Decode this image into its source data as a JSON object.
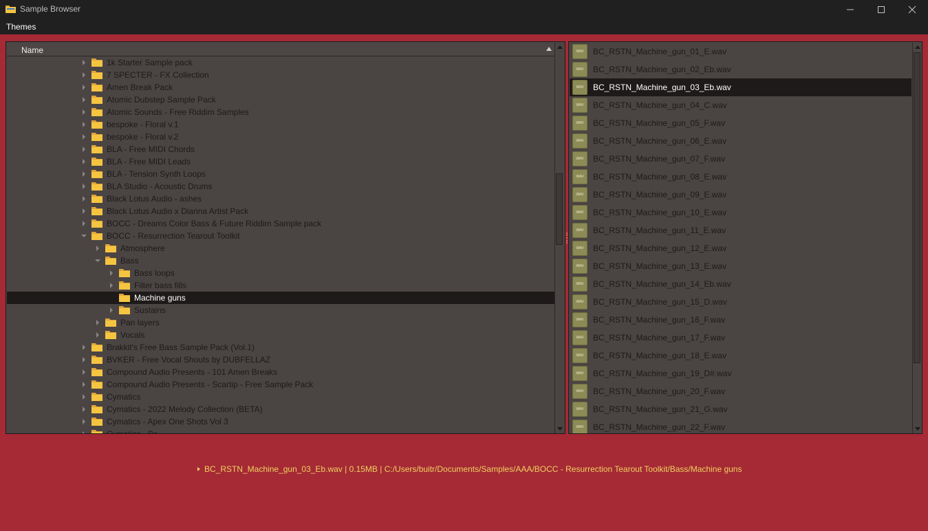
{
  "window": {
    "title": "Sample Browser"
  },
  "menu": {
    "items": [
      "Themes"
    ]
  },
  "tree": {
    "header": "Name",
    "rows": [
      {
        "label": "1k Starter Sample pack",
        "depth": 0,
        "expanded": false,
        "has_children": true
      },
      {
        "label": "7 SPECTER - FX Collection",
        "depth": 0,
        "expanded": false,
        "has_children": true
      },
      {
        "label": "Amen Break Pack",
        "depth": 0,
        "expanded": false,
        "has_children": true
      },
      {
        "label": "Atomic Dubstep Sample Pack",
        "depth": 0,
        "expanded": false,
        "has_children": true
      },
      {
        "label": "Atomic Sounds - Free Riddim Samples",
        "depth": 0,
        "expanded": false,
        "has_children": true
      },
      {
        "label": "bespoke - Floral v.1",
        "depth": 0,
        "expanded": false,
        "has_children": true
      },
      {
        "label": "bespoke - Floral v.2",
        "depth": 0,
        "expanded": false,
        "has_children": true
      },
      {
        "label": "BLA - Free MIDI Chords",
        "depth": 0,
        "expanded": false,
        "has_children": true
      },
      {
        "label": "BLA - Free MIDI Leads",
        "depth": 0,
        "expanded": false,
        "has_children": true
      },
      {
        "label": "BLA - Tension Synth Loops",
        "depth": 0,
        "expanded": false,
        "has_children": true
      },
      {
        "label": "BLA Studio - Acoustic Drums",
        "depth": 0,
        "expanded": false,
        "has_children": true
      },
      {
        "label": "Black Lotus Audio - ashes",
        "depth": 0,
        "expanded": false,
        "has_children": true
      },
      {
        "label": "Black Lotus Audio x Dianna Artist Pack",
        "depth": 0,
        "expanded": false,
        "has_children": true
      },
      {
        "label": "BOCC - Dreams Color Bass & Future Riddim Sample pack",
        "depth": 0,
        "expanded": false,
        "has_children": true
      },
      {
        "label": "BOCC - Resurrection Tearout Toolkit",
        "depth": 0,
        "expanded": true,
        "has_children": true
      },
      {
        "label": "Atmosphere",
        "depth": 1,
        "expanded": false,
        "has_children": true
      },
      {
        "label": "Bass",
        "depth": 1,
        "expanded": true,
        "has_children": true
      },
      {
        "label": "Bass loops",
        "depth": 2,
        "expanded": false,
        "has_children": true
      },
      {
        "label": "Filter bass fills",
        "depth": 2,
        "expanded": false,
        "has_children": true
      },
      {
        "label": "Machine guns",
        "depth": 2,
        "expanded": false,
        "has_children": false,
        "selected": true
      },
      {
        "label": "Sustains",
        "depth": 2,
        "expanded": false,
        "has_children": true
      },
      {
        "label": "Pan layers",
        "depth": 1,
        "expanded": false,
        "has_children": true
      },
      {
        "label": "Vocals",
        "depth": 1,
        "expanded": false,
        "has_children": true
      },
      {
        "label": "Brakkit's Free Bass Sample Pack (Vol.1)",
        "depth": 0,
        "expanded": false,
        "has_children": true
      },
      {
        "label": "BVKER - Free Vocal Shouts by DUBFELLAZ",
        "depth": 0,
        "expanded": false,
        "has_children": true
      },
      {
        "label": "Compound Audio Presents - 101 Amen Breaks",
        "depth": 0,
        "expanded": false,
        "has_children": true
      },
      {
        "label": "Compound Audio Presents - Scartip - Free Sample Pack",
        "depth": 0,
        "expanded": false,
        "has_children": true
      },
      {
        "label": "Cymatics",
        "depth": 0,
        "expanded": false,
        "has_children": true
      },
      {
        "label": "Cymatics - 2022 Melody Collection (BETA)",
        "depth": 0,
        "expanded": false,
        "has_children": true
      },
      {
        "label": "Cymatics - Apex One Shots Vol 3",
        "depth": 0,
        "expanded": false,
        "has_children": true
      },
      {
        "label": "Cymatics - Ba...",
        "depth": 0,
        "expanded": false,
        "has_children": true
      }
    ]
  },
  "files": {
    "icon_text": "WAV",
    "items": [
      {
        "name": "BC_RSTN_Machine_gun_01_E.wav"
      },
      {
        "name": "BC_RSTN_Machine_gun_02_Eb.wav"
      },
      {
        "name": "BC_RSTN_Machine_gun_03_Eb.wav",
        "selected": true
      },
      {
        "name": "BC_RSTN_Machine_gun_04_C.wav"
      },
      {
        "name": "BC_RSTN_Machine_gun_05_F.wav"
      },
      {
        "name": "BC_RSTN_Machine_gun_06_E.wav"
      },
      {
        "name": "BC_RSTN_Machine_gun_07_F.wav"
      },
      {
        "name": "BC_RSTN_Machine_gun_08_E.wav"
      },
      {
        "name": "BC_RSTN_Machine_gun_09_E.wav"
      },
      {
        "name": "BC_RSTN_Machine_gun_10_E.wav"
      },
      {
        "name": "BC_RSTN_Machine_gun_11_E.wav"
      },
      {
        "name": "BC_RSTN_Machine_gun_12_E.wav"
      },
      {
        "name": "BC_RSTN_Machine_gun_13_E.wav"
      },
      {
        "name": "BC_RSTN_Machine_gun_14_Eb.wav"
      },
      {
        "name": "BC_RSTN_Machine_gun_15_D.wav"
      },
      {
        "name": "BC_RSTN_Machine_gun_16_F.wav"
      },
      {
        "name": "BC_RSTN_Machine_gun_17_F.wav"
      },
      {
        "name": "BC_RSTN_Machine_gun_18_E.wav"
      },
      {
        "name": "BC_RSTN_Machine_gun_19_D#.wav"
      },
      {
        "name": "BC_RSTN_Machine_gun_20_F.wav"
      },
      {
        "name": "BC_RSTN_Machine_gun_21_G.wav"
      },
      {
        "name": "BC_RSTN_Machine_gun_22_F.wav"
      }
    ]
  },
  "status": {
    "text": "BC_RSTN_Machine_gun_03_Eb.wav | 0.15MB | C:/Users/buitr/Documents/Samples/AAA/BOCC - Resurrection Tearout Toolkit/Bass/Machine guns"
  },
  "colors": {
    "background": "#a52a35",
    "panel": "#4a4443",
    "selection": "#1e1a1a",
    "status_text": "#f0d060",
    "folder": "#f5c542"
  },
  "icons": {
    "app": "folder-icon",
    "window_controls": [
      "minimize-icon",
      "maximize-icon",
      "close-icon"
    ],
    "tree_item": "folder-icon",
    "file_item": "wav-file-icon"
  }
}
